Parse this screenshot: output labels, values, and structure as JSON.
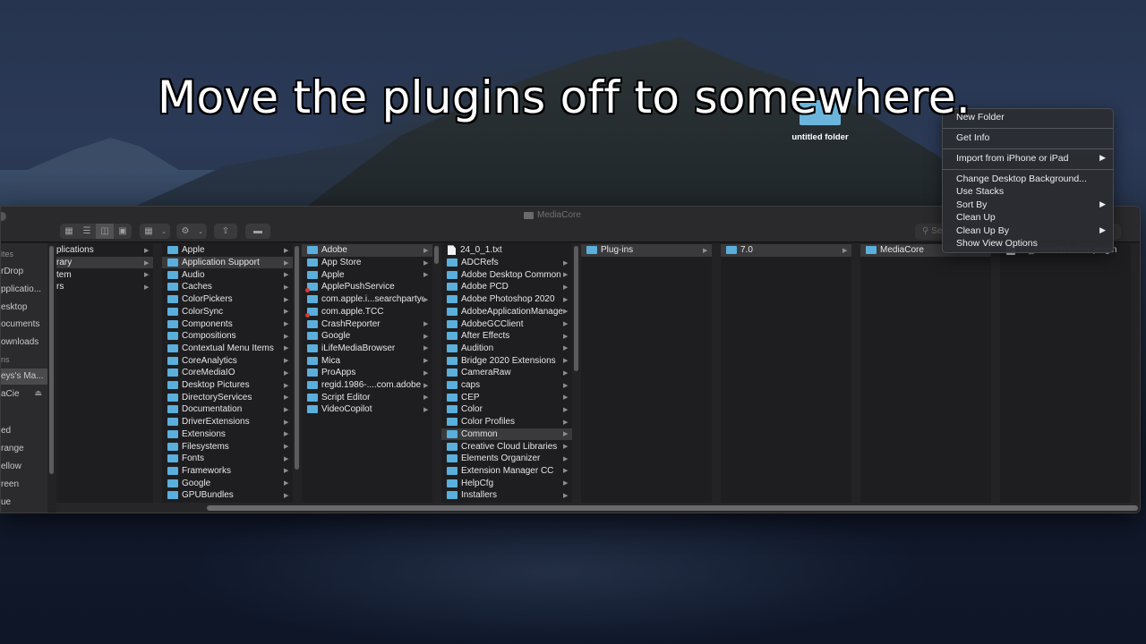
{
  "caption": "Move the plugins off to somewhere.",
  "desktop": {
    "folder_label": "untitled folder"
  },
  "finder": {
    "title": "MediaCore",
    "search_placeholder": "Search",
    "toolbar": {
      "view_icons": [
        "icon-view-icon",
        "list-view-icon",
        "column-view-icon",
        "gallery-view-icon"
      ],
      "active_view": "column"
    },
    "sidebar": [
      {
        "label": "ites",
        "type": "header"
      },
      {
        "label": "rDrop"
      },
      {
        "label": "pplicatio..."
      },
      {
        "label": "esktop"
      },
      {
        "label": "ocuments"
      },
      {
        "label": "ownloads"
      },
      {
        "label": "ns",
        "type": "header"
      },
      {
        "label": "eys's Ma...",
        "selected": true
      },
      {
        "label": "aCie",
        "eject": true
      },
      {
        "label": "",
        "type": "header"
      },
      {
        "label": "ed"
      },
      {
        "label": "range"
      },
      {
        "label": "ellow"
      },
      {
        "label": "reen"
      },
      {
        "label": "ue"
      }
    ],
    "columns": [
      {
        "items": [
          {
            "name": "plications",
            "kind": "folder-noicon",
            "arrow": true
          },
          {
            "name": "rary",
            "kind": "folder-noicon",
            "arrow": true,
            "selected": true
          },
          {
            "name": "tem",
            "kind": "folder-noicon",
            "arrow": true
          },
          {
            "name": "rs",
            "kind": "folder-noicon",
            "arrow": true
          }
        ]
      },
      {
        "items": [
          {
            "name": "Apple",
            "arrow": true
          },
          {
            "name": "Application Support",
            "arrow": true,
            "selected": true
          },
          {
            "name": "Audio",
            "arrow": true
          },
          {
            "name": "Caches",
            "arrow": true
          },
          {
            "name": "ColorPickers",
            "arrow": true
          },
          {
            "name": "ColorSync",
            "arrow": true
          },
          {
            "name": "Components",
            "arrow": true
          },
          {
            "name": "Compositions",
            "arrow": true
          },
          {
            "name": "Contextual Menu Items",
            "arrow": true
          },
          {
            "name": "CoreAnalytics",
            "arrow": true
          },
          {
            "name": "CoreMediaIO",
            "arrow": true
          },
          {
            "name": "Desktop Pictures",
            "arrow": true
          },
          {
            "name": "DirectoryServices",
            "arrow": true
          },
          {
            "name": "Documentation",
            "arrow": true
          },
          {
            "name": "DriverExtensions",
            "arrow": true
          },
          {
            "name": "Extensions",
            "arrow": true
          },
          {
            "name": "Filesystems",
            "arrow": true
          },
          {
            "name": "Fonts",
            "arrow": true
          },
          {
            "name": "Frameworks",
            "arrow": true
          },
          {
            "name": "Google",
            "arrow": true
          },
          {
            "name": "GPUBundles",
            "arrow": true
          }
        ]
      },
      {
        "items": [
          {
            "name": "Adobe",
            "arrow": true,
            "selected": true
          },
          {
            "name": "App Store",
            "arrow": true
          },
          {
            "name": "Apple",
            "arrow": true
          },
          {
            "name": "ApplePushService",
            "arrow": false,
            "locked": true
          },
          {
            "name": "com.apple.i...searchpartyd",
            "arrow": true
          },
          {
            "name": "com.apple.TCC",
            "arrow": false,
            "locked": true
          },
          {
            "name": "CrashReporter",
            "arrow": true
          },
          {
            "name": "Google",
            "arrow": true
          },
          {
            "name": "iLifeMediaBrowser",
            "arrow": true
          },
          {
            "name": "Mica",
            "arrow": true
          },
          {
            "name": "ProApps",
            "arrow": true
          },
          {
            "name": "regid.1986-....com.adobe",
            "arrow": true
          },
          {
            "name": "Script Editor",
            "arrow": true
          },
          {
            "name": "VideoCopilot",
            "arrow": true
          }
        ]
      },
      {
        "items": [
          {
            "name": "24_0_1.txt",
            "kind": "document",
            "arrow": false
          },
          {
            "name": "ADCRefs",
            "arrow": true
          },
          {
            "name": "Adobe Desktop Common",
            "arrow": true
          },
          {
            "name": "Adobe PCD",
            "arrow": true
          },
          {
            "name": "Adobe Photoshop 2020",
            "arrow": true
          },
          {
            "name": "AdobeApplicationManager",
            "arrow": true
          },
          {
            "name": "AdobeGCClient",
            "arrow": true
          },
          {
            "name": "After Effects",
            "arrow": true
          },
          {
            "name": "Audition",
            "arrow": true
          },
          {
            "name": "Bridge 2020 Extensions",
            "arrow": true
          },
          {
            "name": "CameraRaw",
            "arrow": true
          },
          {
            "name": "caps",
            "arrow": true
          },
          {
            "name": "CEP",
            "arrow": true
          },
          {
            "name": "Color",
            "arrow": true
          },
          {
            "name": "Color Profiles",
            "arrow": true
          },
          {
            "name": "Common",
            "arrow": true,
            "selected": true
          },
          {
            "name": "Creative Cloud Libraries",
            "arrow": true
          },
          {
            "name": "Elements Organizer",
            "arrow": true
          },
          {
            "name": "Extension Manager CC",
            "arrow": true
          },
          {
            "name": "HelpCfg",
            "arrow": true
          },
          {
            "name": "Installers",
            "arrow": true
          }
        ]
      },
      {
        "items": [
          {
            "name": "Plug-ins",
            "arrow": true,
            "selected": true
          }
        ]
      },
      {
        "items": [
          {
            "name": "7.0",
            "arrow": true,
            "selected": true
          }
        ]
      },
      {
        "items": [
          {
            "name": "MediaCore",
            "arrow": false,
            "selected": true
          }
        ]
      },
      {
        "items": [
          {
            "name": "CI_PowerWindow.plugin",
            "kind": "plugin",
            "arrow": false
          }
        ]
      }
    ]
  },
  "context_menu": {
    "groups": [
      [
        {
          "label": "New Folder"
        }
      ],
      [
        {
          "label": "Get Info"
        }
      ],
      [
        {
          "label": "Import from iPhone or iPad",
          "submenu": true
        }
      ],
      [
        {
          "label": "Change Desktop Background..."
        },
        {
          "label": "Use Stacks"
        },
        {
          "label": "Sort By",
          "submenu": true
        },
        {
          "label": "Clean Up"
        },
        {
          "label": "Clean Up By",
          "submenu": true
        },
        {
          "label": "Show View Options"
        }
      ]
    ]
  }
}
